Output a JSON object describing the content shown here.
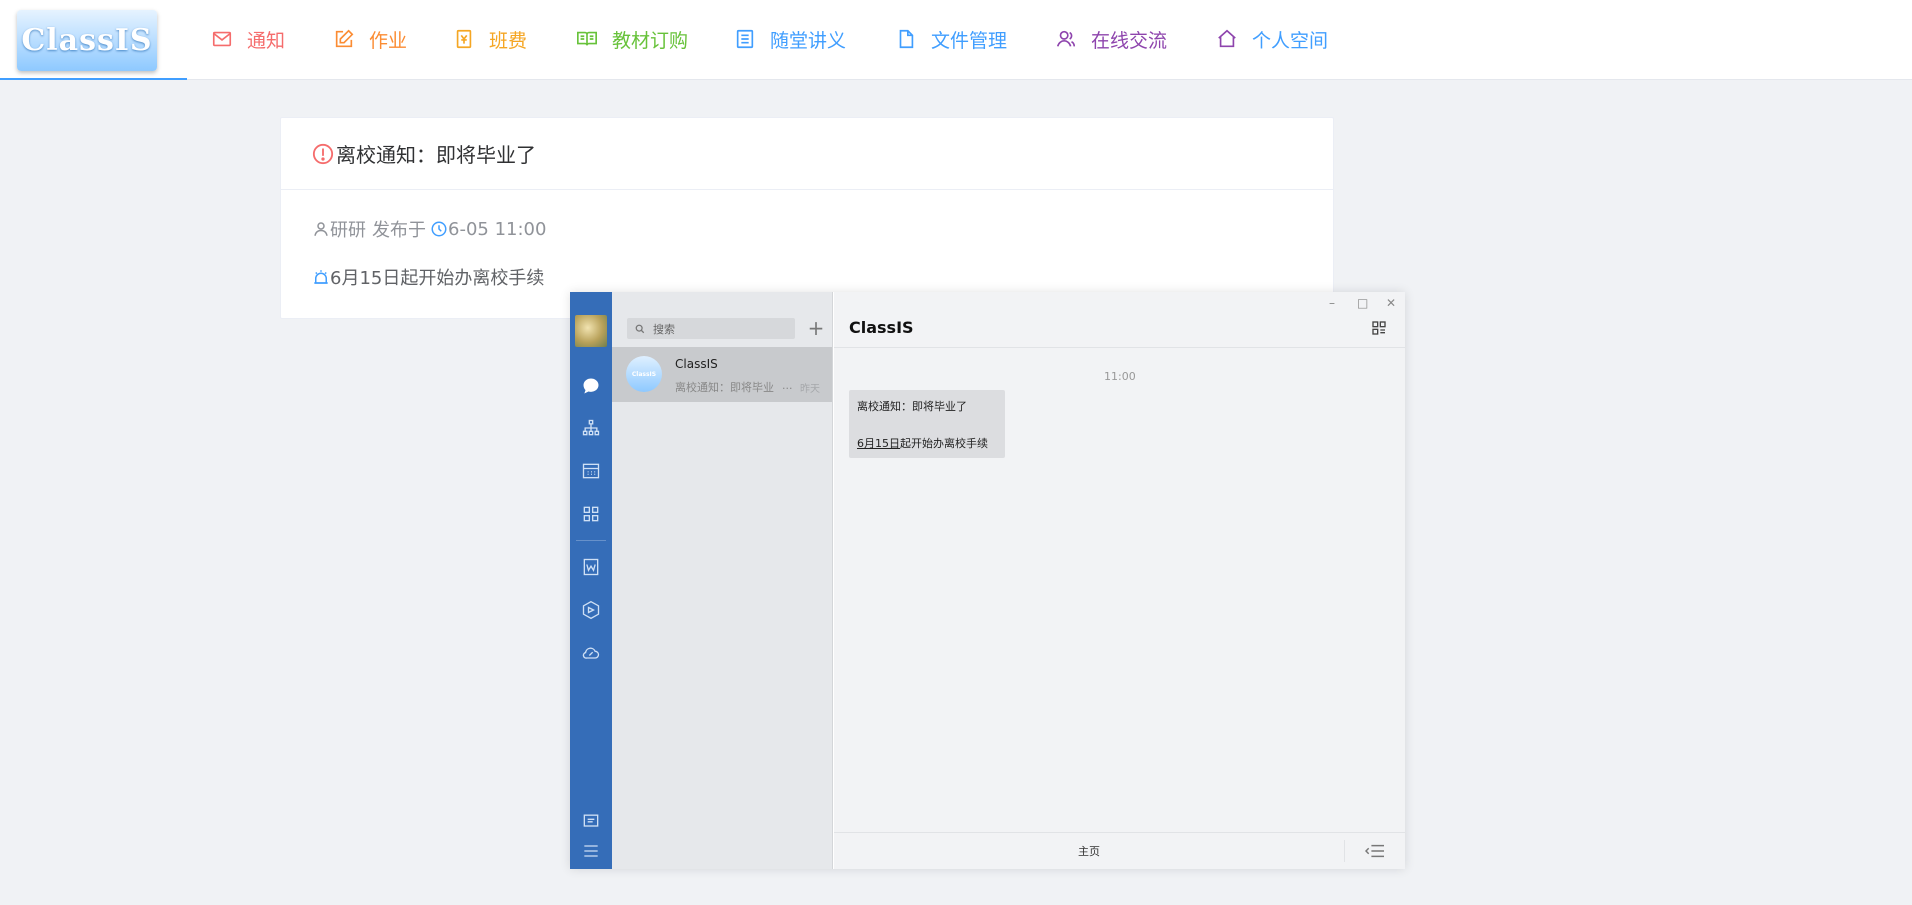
{
  "logo": {
    "text": "ClassIS"
  },
  "nav": [
    {
      "label": "通知",
      "icon": "mail-icon",
      "color": "#f56c6c"
    },
    {
      "label": "作业",
      "icon": "edit-icon",
      "color": "#fb8c33"
    },
    {
      "label": "班费",
      "icon": "money-icon",
      "color": "#f5a623"
    },
    {
      "label": "教材订购",
      "icon": "book-icon",
      "color": "#67c23a"
    },
    {
      "label": "随堂讲义",
      "icon": "list-doc-icon",
      "color": "#409eff"
    },
    {
      "label": "文件管理",
      "icon": "file-icon",
      "color": "#409eff"
    },
    {
      "label": "在线交流",
      "icon": "users-icon",
      "color": "#8e44ad"
    },
    {
      "label": "个人空间",
      "icon": "home-icon",
      "color": "#409eff"
    }
  ],
  "notice": {
    "title": "离校通知：即将毕业了",
    "author": "研研",
    "published_label": "发布于",
    "time": "6-05 11:00",
    "content": "6月15日起开始办离校手续"
  },
  "chat": {
    "search_placeholder": "搜索",
    "add_label": "+",
    "conversation": {
      "name": "ClassIS",
      "avatar_text": "ClassIS",
      "preview": "离校通知：即将毕业",
      "preview_more": "...",
      "time": "昨天"
    },
    "window_controls": {
      "minimize": "–",
      "maximize": "□",
      "close": "✕"
    },
    "title": "ClassIS",
    "message_time": "11:00",
    "message": {
      "line1": "离校通知：即将毕业了",
      "date_link": "6月15日",
      "rest": "起开始办离校手续"
    },
    "footer_home": "主页"
  },
  "colors": {
    "accent": "#409eff",
    "rail": "#356db8",
    "warning": "#f56c6c"
  }
}
